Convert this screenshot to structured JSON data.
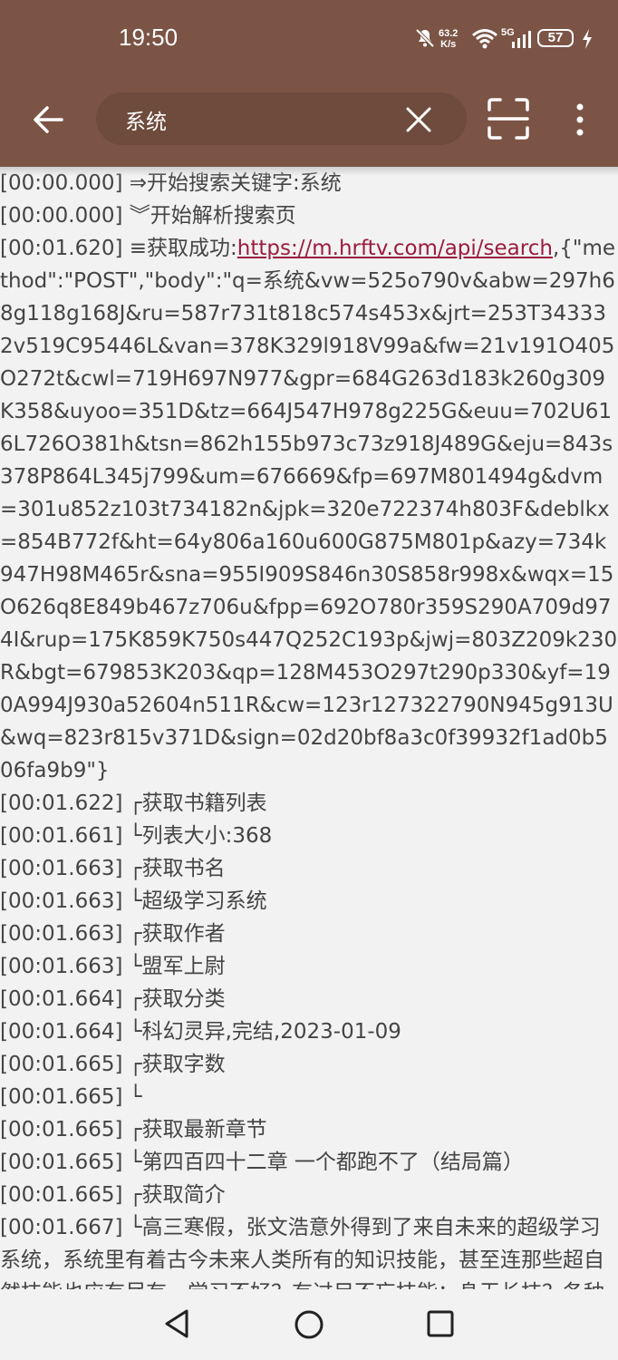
{
  "status_bar": {
    "time": "19:50",
    "net_speed_value": "63.2",
    "net_speed_unit": "K/s",
    "network_label": "5G",
    "battery": "57",
    "icons": [
      "mute-icon",
      "wifi-icon",
      "signal-icon",
      "battery-icon",
      "charging-icon"
    ]
  },
  "toolbar": {
    "back_icon": "arrow-left-icon",
    "search_value": "系统",
    "search_placeholder": "",
    "clear_icon": "close-icon",
    "scan_icon": "scan-icon",
    "more_icon": "more-vertical-icon"
  },
  "log": {
    "l1_ts": "[00:00.000]",
    "l1_text": " ⇒开始搜索关键字:系统",
    "l2_ts": "[00:00.000]",
    "l2_text": " ︾开始解析搜索页",
    "l3_ts": "[00:01.620]",
    "l3_prefix": " ≡获取成功:",
    "l3_url": "https://m.hrftv.com/api/search",
    "l3_body": ",{\"method\":\"POST\",\"body\":\"q=系统&vw=525o790v&abw=297h68g118g168J&ru=587r731t818c574s453x&jrt=253T343332v519C95446L&van=378K329l918V99a&fw=21v191O405O272t&cwl=719H697N977&gpr=684G263d183k260g309K358&uyoo=351D&tz=664J547H978g225G&euu=702U616L726O381h&tsn=862h155b973c73z918J489G&eju=843s378P864L345j799&um=676669&fp=697M801494g&dvm=301u852z103t734182n&jpk=320e722374h803F&deblkx=854B772f&ht=64y806a160u600G875M801p&azy=734k947H98M465r&sna=955I909S846n30S858r998x&wqx=15O626q8E849b467z706u&fpp=692O780r359S290A709d974I&rup=175K859K750s447Q252C193p&jwj=803Z209k230R&bgt=679853K203&qp=128M453O297t290p330&yf=190A994J930a52604n511R&cw=123r127322790N945g913U&wq=823r815v371D&sign=02d20bf8a3c0f39932f1ad0b506fa9b9\"}",
    "l4_ts": "[00:01.622]",
    "l4_text": " ┌获取书籍列表",
    "l5_ts": "[00:01.661]",
    "l5_text": " └列表大小:368",
    "l6_ts": "[00:01.663]",
    "l6_text": " ┌获取书名",
    "l7_ts": "[00:01.663]",
    "l7_text": " └超级学习系统",
    "l8_ts": "[00:01.663]",
    "l8_text": " ┌获取作者",
    "l9_ts": "[00:01.663]",
    "l9_text": " └盟军上尉",
    "l10_ts": "[00:01.664]",
    "l10_text": " ┌获取分类",
    "l11_ts": "[00:01.664]",
    "l11_text": " └科幻灵异,完结,2023-01-09",
    "l12_ts": "[00:01.665]",
    "l12_text": " ┌获取字数",
    "l13_ts": "[00:01.665]",
    "l13_text": " └",
    "l14_ts": "[00:01.665]",
    "l14_text": " ┌获取最新章节",
    "l15_ts": "[00:01.665]",
    "l15_text": " └第四百四十二章 一个都跑不了（结局篇）",
    "l16_ts": "[00:01.665]",
    "l16_text": " ┌获取简介",
    "l17_ts": "[00:01.667]",
    "l17_text": " └高三寒假，张文浩意外得到了来自未来的超级学习系统，系统里有着古今未来人类所有的知识技能，甚至连那些超自然技能也应有尽有。学习不好？有过目不忘技能；身无长技？各种职业技能随便挑；赚钱太少？最强医术要不要？未来科技来一套；还是不爽？超自然异能好不好？泡不到妞？你特么在耍我？学了一身本领，泡妞"
  },
  "nav": {
    "back_icon": "nav-back-icon",
    "home_icon": "nav-home-icon",
    "recents_icon": "nav-recents-icon"
  },
  "colors": {
    "appbar": "#7b5445",
    "search_box": "#6e4b3d",
    "link": "#9b1c3e",
    "background": "#f2f2f2"
  }
}
